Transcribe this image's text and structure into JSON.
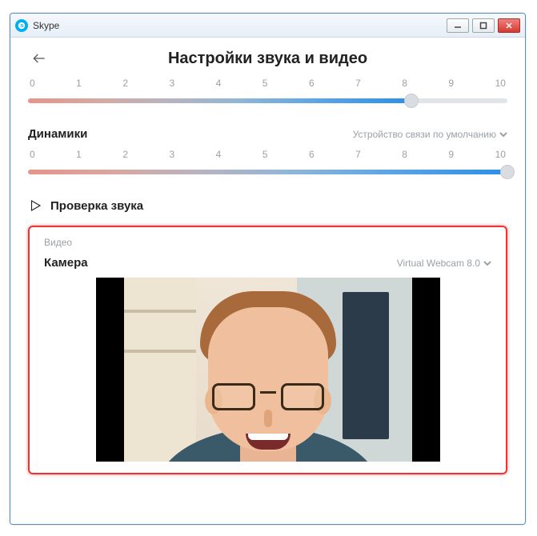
{
  "window": {
    "title": "Skype"
  },
  "header": {
    "title": "Настройки звука и видео"
  },
  "mic_slider": {
    "ticks": [
      "0",
      "1",
      "2",
      "3",
      "4",
      "5",
      "6",
      "7",
      "8",
      "9",
      "10"
    ],
    "value": 8,
    "max": 10
  },
  "speakers": {
    "label": "Динамики",
    "device": "Устройство связи по умолчанию",
    "ticks": [
      "0",
      "1",
      "2",
      "3",
      "4",
      "5",
      "6",
      "7",
      "8",
      "9",
      "10"
    ],
    "value": 10,
    "max": 10
  },
  "test_sound": {
    "label": "Проверка звука"
  },
  "video": {
    "heading": "Видео",
    "camera_label": "Камера",
    "camera_device": "Virtual Webcam 8.0"
  }
}
